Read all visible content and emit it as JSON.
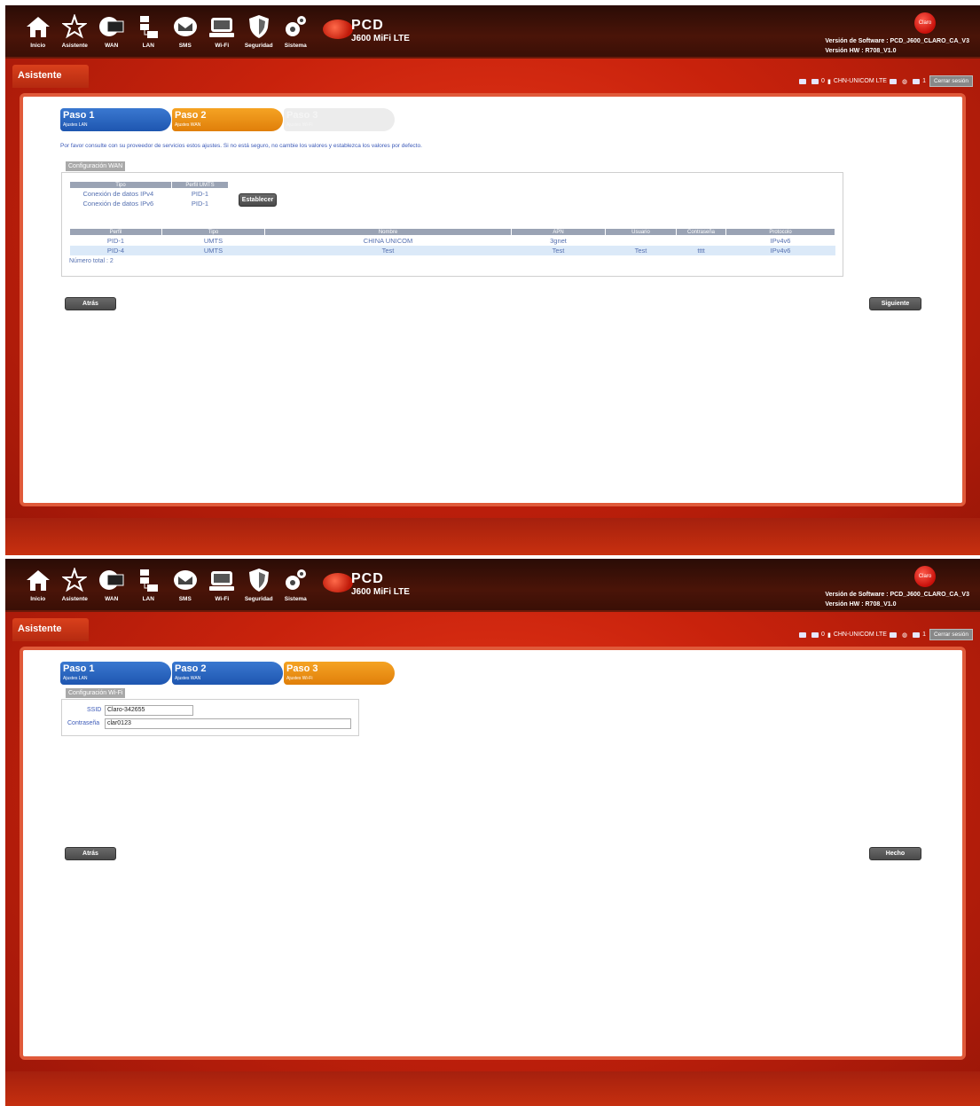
{
  "nav": [
    {
      "label": "Inicio",
      "icon": "home-icon"
    },
    {
      "label": "Asistente",
      "icon": "wizard-icon"
    },
    {
      "label": "WAN",
      "icon": "wan-icon"
    },
    {
      "label": "LAN",
      "icon": "lan-icon"
    },
    {
      "label": "SMS",
      "icon": "sms-icon"
    },
    {
      "label": "Wi-Fi",
      "icon": "wifi-icon"
    },
    {
      "label": "Seguridad",
      "icon": "shield-icon"
    },
    {
      "label": "Sistema",
      "icon": "gear-icon"
    }
  ],
  "brand": {
    "name": "PCD",
    "model": "J600 MiFi LTE",
    "operator_logo": "Claro"
  },
  "version": {
    "software": "Versión de Software : PCD_J600_CLARO_CA_V3",
    "hardware": "Versión HW : R708_V1.0"
  },
  "page_title": "Asistente",
  "status": {
    "sms_count": "0",
    "network": "CHN-UNICOM  LTE",
    "devices": "1",
    "logout": "Cerrar sesión"
  },
  "steps": [
    {
      "name": "Paso 1",
      "sub": "Ajustes LAN"
    },
    {
      "name": "Paso 2",
      "sub": "Ajustes WAN"
    },
    {
      "name": "Paso 3",
      "sub": "Ajustes Wi-Fi"
    }
  ],
  "screen1": {
    "note": "Por favor consulte con su proveedor de servicios estos ajustes. Si no está seguro, no cambie los valores y establezca los valores por defecto.",
    "section": "Configuración WAN",
    "conn_headers": [
      "Tipo",
      "Perfil UMTS"
    ],
    "conn_rows": [
      [
        "Conexión de datos IPv4",
        "PID-1"
      ],
      [
        "Conexión de datos IPv6",
        "PID-1"
      ]
    ],
    "set_button": "Establecer",
    "profile_headers": [
      "Perfil",
      "Tipo",
      "Nombre",
      "APN",
      "Usuario",
      "Contraseña",
      "Protocolo"
    ],
    "profile_rows": [
      [
        "PID-1",
        "UMTS",
        "CHINA UNICOM",
        "3gnet",
        "",
        "",
        "IPv4v6"
      ],
      [
        "PID-4",
        "UMTS",
        "Test",
        "Test",
        "Test",
        "tttt",
        "IPv4v6"
      ]
    ],
    "total": "Número total : 2",
    "back": "Atrás",
    "next": "Siguiente"
  },
  "screen2": {
    "section": "Configuración Wi-Fi",
    "ssid_label": "SSID",
    "ssid_value": "Claro-342655",
    "password_label": "Contraseña",
    "password_value": "clar0123",
    "back": "Atrás",
    "done": "Hecho"
  },
  "colors": {
    "step_blue": "#1e56b0",
    "step_orange": "#e07f0a",
    "background_red": "#c8220c"
  }
}
